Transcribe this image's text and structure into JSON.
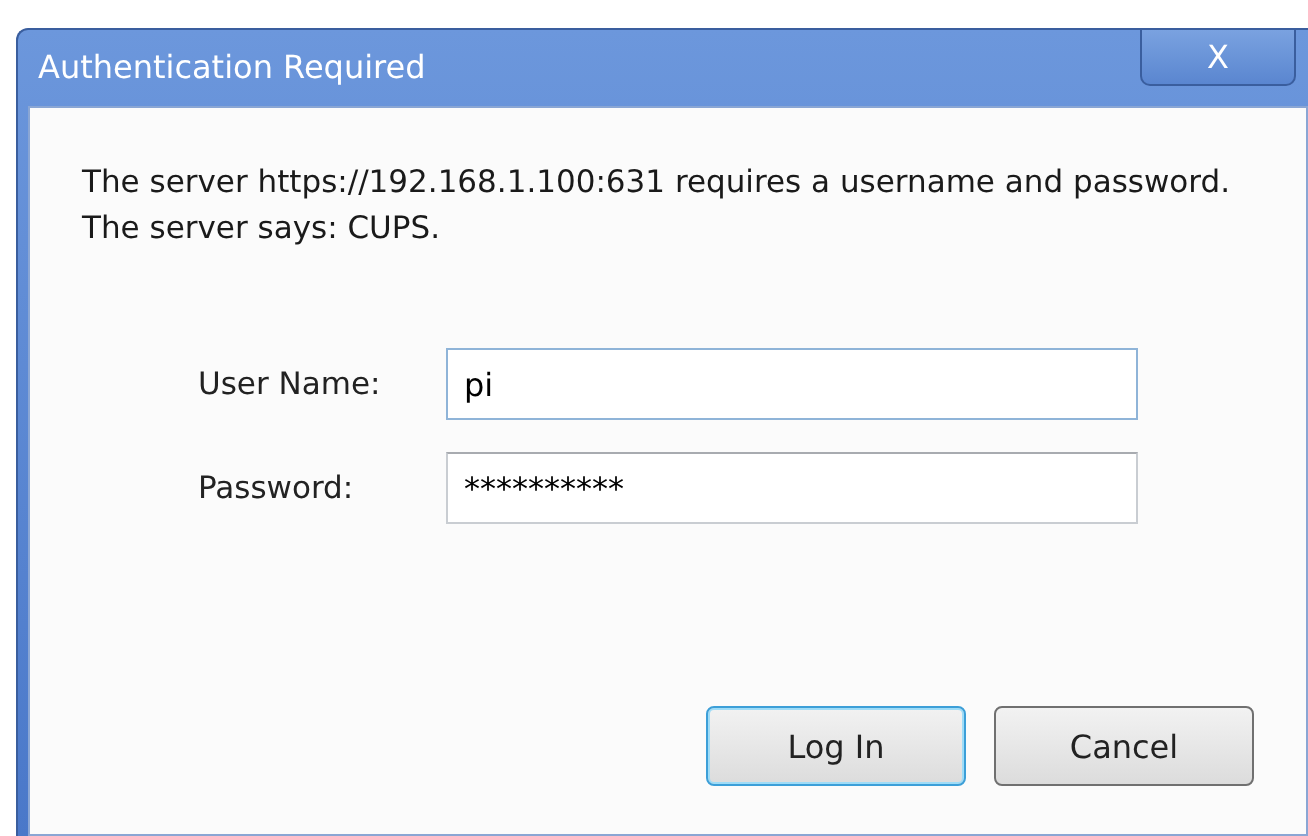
{
  "window": {
    "title": "Authentication Required",
    "close": "X"
  },
  "message": "The server https://192.168.1.100:631 requires a username and password. The server says: CUPS.",
  "fields": [
    {
      "label": "User Name:",
      "value": "pi"
    },
    {
      "label": "Password:",
      "value": "**********"
    }
  ],
  "buttons": [
    {
      "label": "Log In",
      "default": true
    },
    {
      "label": "Cancel",
      "default": false
    }
  ]
}
